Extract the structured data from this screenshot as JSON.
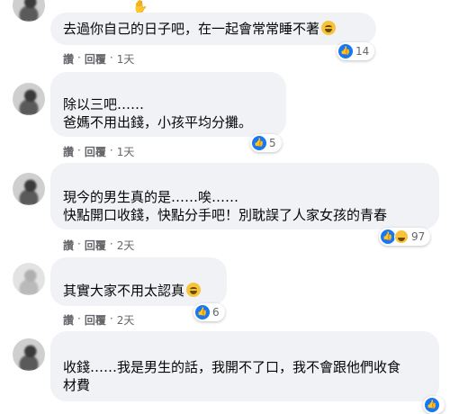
{
  "colors": {
    "bubble": "#f0f2f5",
    "like": "#1877f2",
    "meta": "#65676b",
    "text": "#050505"
  },
  "comments": [
    {
      "lines": [
        "去過你自己的日子吧，在一起會常常睡不著"
      ],
      "emoji": "laughing-emoji",
      "reactions": {
        "icons": [
          "like"
        ],
        "count": "14"
      },
      "actions": {
        "like": "讚",
        "reply": "回覆",
        "time": "1天"
      }
    },
    {
      "lines": [
        "除以三吧……",
        "爸媽不用出錢，小孩平均分攤。"
      ],
      "reactions": {
        "icons": [
          "like"
        ],
        "count": "5"
      },
      "actions": {
        "like": "讚",
        "reply": "回覆",
        "time": "1天"
      }
    },
    {
      "lines": [
        "現今的男生真的是……唉……",
        "快點開口收錢，快點分手吧！別耽誤了人家女孩的青春"
      ],
      "reactions": {
        "icons": [
          "like",
          "haha"
        ],
        "count": "97"
      },
      "actions": {
        "like": "讚",
        "reply": "回覆",
        "time": "2天"
      }
    },
    {
      "lines": [
        "其實大家不用太認真"
      ],
      "emoji": "laughing-emoji",
      "reactions": {
        "icons": [
          "like"
        ],
        "count": "6"
      },
      "actions": {
        "like": "讚",
        "reply": "回覆",
        "time": "2天"
      }
    },
    {
      "lines": [
        "收錢……我是男生的話，我開不了口，我不會跟他們收食",
        "材費"
      ],
      "reactions": {
        "icons": [
          "like"
        ],
        "count": ""
      },
      "actions": {
        "like": "",
        "reply": "",
        "time": ""
      }
    }
  ]
}
